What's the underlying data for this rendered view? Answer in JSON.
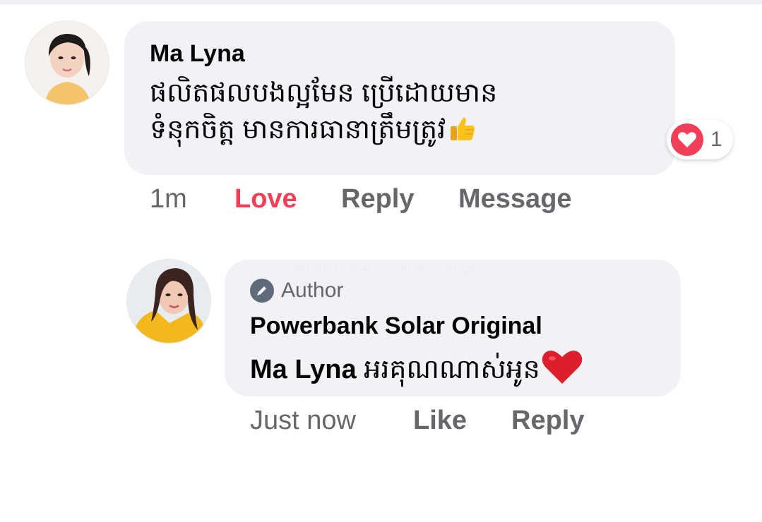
{
  "comment": {
    "author": "Ma Lyna",
    "text_line1": "ផលិតផលបងល្អមែន ប្រើដោយមាន",
    "text_line2": "ទំនុកចិត្ត មានការធានាត្រឹមត្រូវ",
    "emoji": "thumbs-up-emoji",
    "reaction": {
      "icon": "heart-icon",
      "count": "1",
      "color": "#f33e58"
    },
    "actions": {
      "time": "1m",
      "love": "Love",
      "reply": "Reply",
      "message": "Message"
    }
  },
  "reply": {
    "badge": "Author",
    "author": "Powerbank Solar Original",
    "mention": "Ma Lyna",
    "text": " អរគុណណាស់អូន",
    "emoji": "red-heart-emoji",
    "actions": {
      "time": "Just now",
      "like": "Like",
      "reply": "Reply"
    }
  },
  "watermark": "www.khmer24.com/Darasakasa",
  "colors": {
    "bubble": "#f0f2f5",
    "secondary_text": "#65676b",
    "love": "#f33e58"
  }
}
